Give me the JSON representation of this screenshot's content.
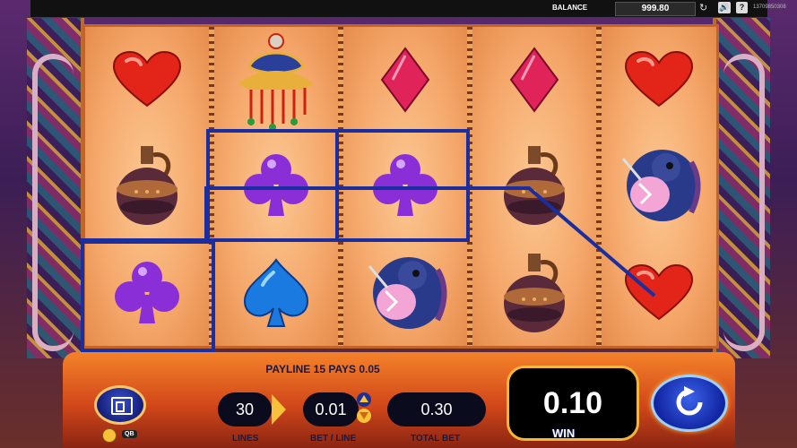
{
  "top_bar": {
    "balance_label": "BALANCE",
    "balance_value": "999.80",
    "help_label": "?",
    "session_id": "13709850308",
    "icons": [
      "refresh-icon",
      "sound-icon",
      "help-icon"
    ]
  },
  "reels": {
    "columns": [
      [
        "heart",
        "jug",
        "club"
      ],
      [
        "jewel-ornament",
        "club",
        "spade"
      ],
      [
        "diamond",
        "club",
        "monkey"
      ],
      [
        "diamond",
        "jug",
        "jug"
      ],
      [
        "heart",
        "monkey",
        "heart"
      ]
    ],
    "winning_cells": [
      [
        0,
        2
      ],
      [
        1,
        1
      ],
      [
        2,
        1
      ]
    ]
  },
  "panel": {
    "payline_message": "PAYLINE 15 PAYS 0.05",
    "lines_value": "30",
    "lines_label": "LINES",
    "bet_line_value": "0.01",
    "bet_line_label": "BET / LINE",
    "total_bet_value": "0.30",
    "total_bet_label": "TOTAL BET",
    "win_value": "0.10",
    "win_label": "WIN",
    "qb_label": "QB"
  },
  "colors": {
    "payline": "#1a2ea0",
    "accent": "#f5c23a",
    "panel": "#d2481a"
  }
}
